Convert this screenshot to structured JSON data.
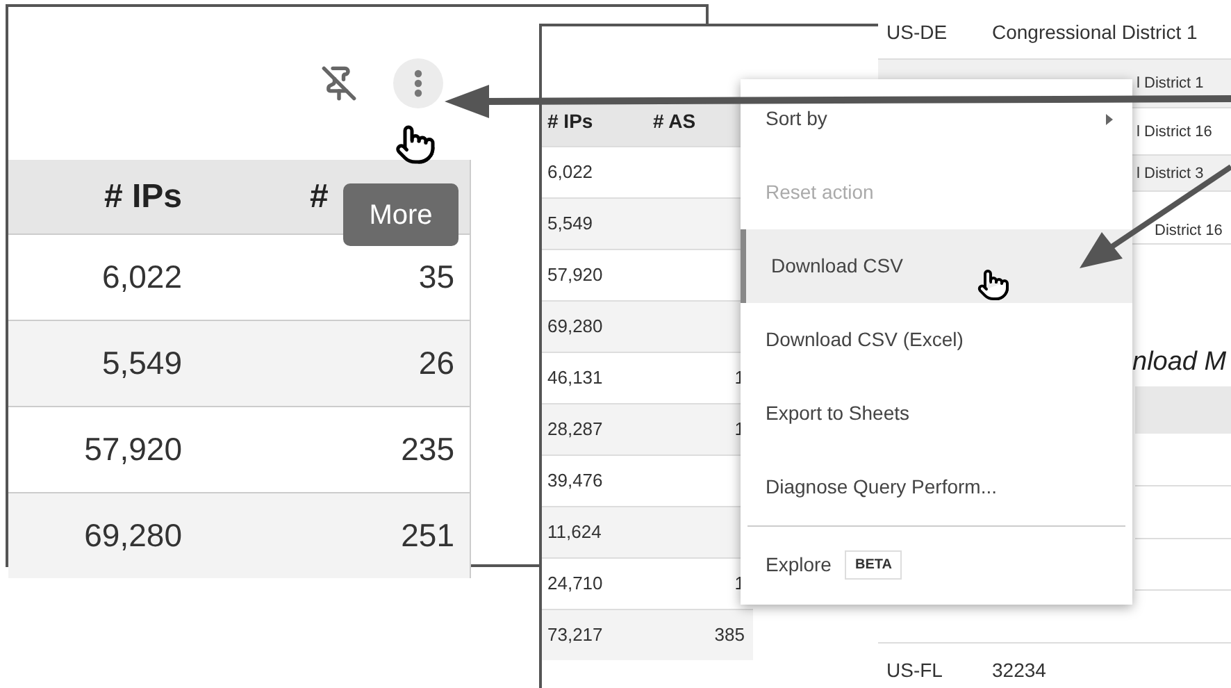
{
  "zoomed_view": {
    "table": {
      "columns": [
        "# IPs",
        "#"
      ],
      "rows": [
        [
          "6,022",
          "35"
        ],
        [
          "5,549",
          "26"
        ],
        [
          "57,920",
          "235"
        ],
        [
          "69,280",
          "251"
        ]
      ]
    },
    "tooltip": "More"
  },
  "full_view": {
    "table": {
      "columns": [
        "# IPs",
        "# AS"
      ],
      "rows": [
        [
          "6,022",
          ""
        ],
        [
          "5,549",
          ""
        ],
        [
          "57,920",
          ""
        ],
        [
          "69,280",
          ""
        ],
        [
          "46,131",
          "1"
        ],
        [
          "28,287",
          "1"
        ],
        [
          "39,476",
          ""
        ],
        [
          "11,624",
          ""
        ],
        [
          "24,710",
          "1"
        ],
        [
          "73,217",
          "385"
        ]
      ]
    },
    "background_table": {
      "rows": [
        {
          "column_1": "US-DE",
          "column_2": "Congressional District 1"
        },
        {
          "column_2": "l District 1"
        },
        {
          "column_2": "l District 16"
        },
        {
          "column_2": "l District 3"
        },
        {
          "column_2": "District 16"
        }
      ],
      "heading": "nload M",
      "last_row": {
        "column_1": "US-FL",
        "column_2": "32234"
      }
    },
    "menu": {
      "items": [
        {
          "kind": "item",
          "label": "Sort by",
          "submenu": true,
          "disabled": false,
          "selected": false
        },
        {
          "kind": "item",
          "label": "Reset action",
          "submenu": false,
          "disabled": true,
          "selected": false
        },
        {
          "kind": "item",
          "label": "Download CSV",
          "submenu": false,
          "disabled": false,
          "selected": true
        },
        {
          "kind": "item",
          "label": "Download CSV (Excel)",
          "submenu": false,
          "disabled": false,
          "selected": false
        },
        {
          "kind": "item",
          "label": "Export to Sheets",
          "submenu": false,
          "disabled": false,
          "selected": false
        },
        {
          "kind": "item",
          "label": "Diagnose Query Perform...",
          "submenu": false,
          "disabled": false,
          "selected": false
        },
        {
          "kind": "divider"
        },
        {
          "kind": "item",
          "label": "Explore",
          "badge": "BETA",
          "submenu": false,
          "disabled": false,
          "selected": false
        }
      ]
    }
  }
}
